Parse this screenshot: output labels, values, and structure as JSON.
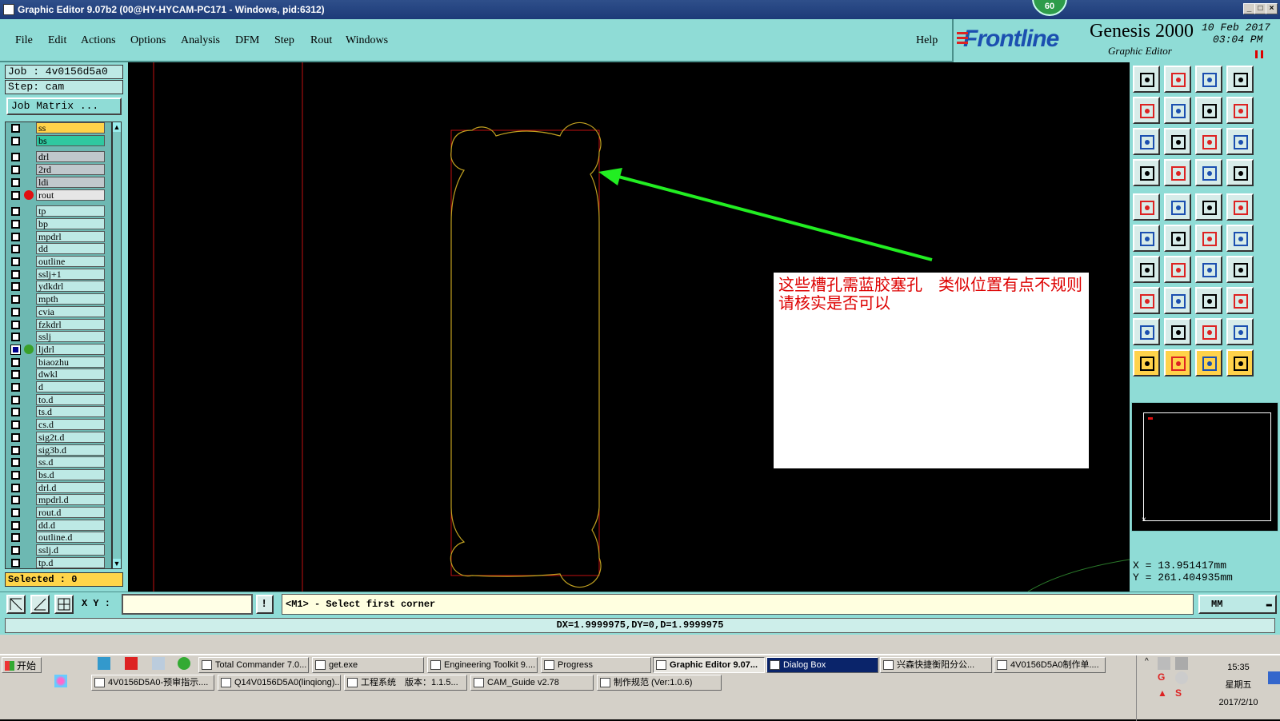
{
  "window": {
    "title": "Graphic Editor 9.07b2 (00@HY-HYCAM-PC171 - Windows, pid:6312)",
    "badge": "60",
    "controls": [
      "_",
      "□",
      "×"
    ]
  },
  "menu": {
    "items": [
      "File",
      "Edit",
      "Actions",
      "Options",
      "Analysis",
      "DFM",
      "Step",
      "Rout",
      "Windows"
    ],
    "help": "Help"
  },
  "brand": {
    "logo": "Frontline",
    "product": "Genesis 2000",
    "subtitle": "Graphic Editor",
    "date_line1": "10 Feb 2017",
    "date_line2": "03:04 PM"
  },
  "job": {
    "job_label": "Job : 4v0156d5a0",
    "step_label": "Step: cam",
    "matrix_button": "Job Matrix ..."
  },
  "layers": [
    {
      "name": "ss",
      "color": "#ffd24a",
      "mark": "⬋"
    },
    {
      "name": "bs",
      "color": "#2fc8a0",
      "mark": ""
    },
    {
      "name": "drl",
      "color": "#c0c8cc",
      "mark": ""
    },
    {
      "name": "2rd",
      "color": "#c0c8cc",
      "mark": ""
    },
    {
      "name": "ldi",
      "color": "#c0c8cc",
      "mark": ""
    },
    {
      "name": "rout",
      "color": "#e6e6e6",
      "mark": "",
      "dot": "#e01010"
    },
    {
      "name": "tp",
      "color": "#bde9e5",
      "mark": ""
    },
    {
      "name": "bp",
      "color": "#bde9e5",
      "mark": ""
    },
    {
      "name": "mpdrl",
      "color": "#bde9e5",
      "mark": ""
    },
    {
      "name": "dd",
      "color": "#bde9e5",
      "mark": "⬋"
    },
    {
      "name": "outline",
      "color": "#bde9e5",
      "mark": ""
    },
    {
      "name": "sslj+1",
      "color": "#bde9e5",
      "mark": ""
    },
    {
      "name": "ydkdrl",
      "color": "#bde9e5",
      "mark": ""
    },
    {
      "name": "mpth",
      "color": "#bde9e5",
      "mark": ""
    },
    {
      "name": "cvia",
      "color": "#bde9e5",
      "mark": ""
    },
    {
      "name": "fzkdrl",
      "color": "#bde9e5",
      "mark": ""
    },
    {
      "name": "sslj",
      "color": "#bde9e5",
      "mark": ""
    },
    {
      "name": "ljdrl",
      "color": "#bde9e5",
      "mark": "▤",
      "dot": "#3aa02a",
      "checked": true
    },
    {
      "name": "biaozhu",
      "color": "#bde9e5",
      "mark": ""
    },
    {
      "name": "dwkl",
      "color": "#bde9e5",
      "mark": ""
    },
    {
      "name": "d",
      "color": "#bde9e5",
      "mark": ""
    },
    {
      "name": "to.d",
      "color": "#bde9e5",
      "mark": ""
    },
    {
      "name": "ts.d",
      "color": "#bde9e5",
      "mark": ""
    },
    {
      "name": "cs.d",
      "color": "#bde9e5",
      "mark": "⬋"
    },
    {
      "name": "sig2t.d",
      "color": "#bde9e5",
      "mark": "⬋"
    },
    {
      "name": "sig3b.d",
      "color": "#bde9e5",
      "mark": "⬋"
    },
    {
      "name": "ss.d",
      "color": "#bde9e5",
      "mark": "⬋"
    },
    {
      "name": "bs.d",
      "color": "#bde9e5",
      "mark": ""
    },
    {
      "name": "drl.d",
      "color": "#bde9e5",
      "mark": ""
    },
    {
      "name": "mpdrl.d",
      "color": "#bde9e5",
      "mark": ""
    },
    {
      "name": "rout.d",
      "color": "#bde9e5",
      "mark": ""
    },
    {
      "name": "dd.d",
      "color": "#bde9e5",
      "mark": "⬋"
    },
    {
      "name": "outline.d",
      "color": "#bde9e5",
      "mark": ""
    },
    {
      "name": "sslj.d",
      "color": "#bde9e5",
      "mark": ""
    },
    {
      "name": "tp.d",
      "color": "#bde9e5",
      "mark": ""
    }
  ],
  "selected": "Selected : 0",
  "canvas": {
    "note": "这些槽孔需蓝胶塞孔　类似位置有点不规则　请核实是否可以",
    "arrow_color": "#22ee22",
    "outline_color": "#c0a020",
    "rout_color": "#e01010"
  },
  "coords": {
    "x": "X = 13.951417mm",
    "y": "Y = 261.404935mm"
  },
  "bottom": {
    "xy_label": "X Y :",
    "xy_value": "",
    "message": "<M1> - Select first corner",
    "units": "MM"
  },
  "status": {
    "dx": "DX=1.9999975,DY=0,D=1.9999975"
  },
  "taskbar": {
    "start": "开始",
    "row1": [
      {
        "label": "Total Commander 7.0..."
      },
      {
        "label": "get.exe"
      },
      {
        "label": "Engineering Toolkit 9...."
      },
      {
        "label": "Progress"
      },
      {
        "label": "Graphic Editor 9.07...",
        "active": true
      },
      {
        "label": "Dialog Box",
        "dark": true
      },
      {
        "label": "兴森快捷衡阳分公..."
      },
      {
        "label": "4V0156D5A0制作单...."
      }
    ],
    "row2": [
      {
        "label": "4V0156D5A0-预审指示...."
      },
      {
        "label": "Q14V0156D5A0(linqiong)..."
      },
      {
        "label": "工程系统　版本：1.1.5..."
      },
      {
        "label": "CAM_Guide v2.78"
      },
      {
        "label": "制作规范 (Ver:1.0.6)"
      }
    ],
    "clock_time": "15:35",
    "clock_day": "星期五",
    "clock_date": "2017/2/10"
  }
}
